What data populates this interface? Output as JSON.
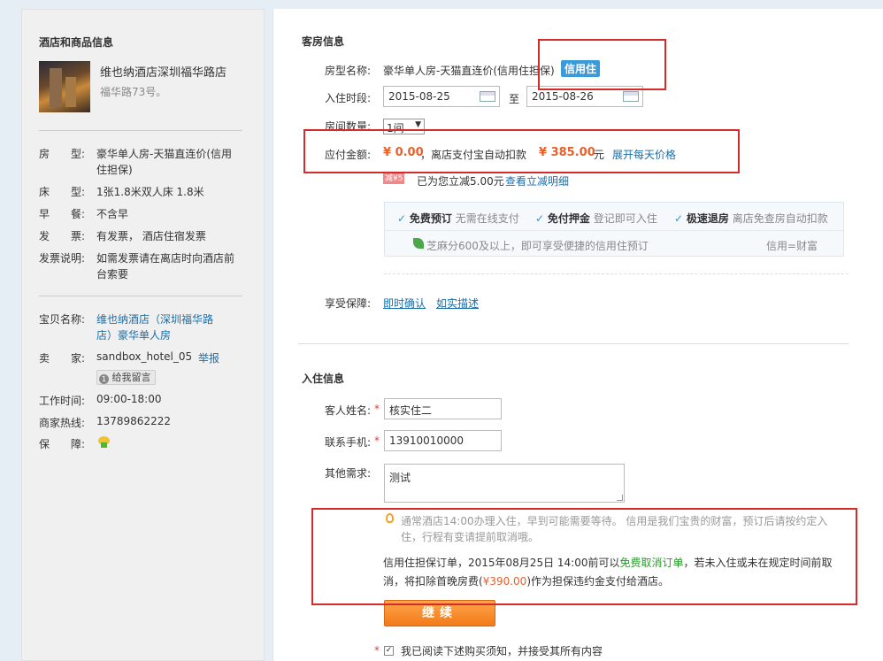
{
  "sidebar": {
    "title": "酒店和商品信息",
    "hotel_name": "维也纳酒店深圳福华路店",
    "hotel_address": "福华路73号。",
    "rows": [
      {
        "label": "房　　型:",
        "value": "豪华单人房-天猫直连价(信用住担保)"
      },
      {
        "label": "床　　型:",
        "value": "1张1.8米双人床 1.8米"
      },
      {
        "label": "早　　餐:",
        "value": "不含早"
      },
      {
        "label": "发　　票:",
        "value": "有发票， 酒店住宿发票"
      },
      {
        "label": "发票说明:",
        "value": "如需发票请在离店时向酒店前台索要"
      }
    ],
    "product_label": "宝贝名称:",
    "product_name": "维也纳酒店（深圳福华路店）豪华单人房",
    "seller_label": "卖　　家:",
    "seller_name": "sandbox_hotel_05",
    "report_link": "举报",
    "message_button": "给我留言",
    "hours_label": "工作时间:",
    "hours_value": "09:00-18:00",
    "hotline_label": "商家热线:",
    "hotline_value": "13789862222",
    "guarantee_label": "保　　障:"
  },
  "room": {
    "section_title": "客房信息",
    "room_type_label": "房型名称:",
    "room_type_value": "豪华单人房-天猫直连价(信用住担保)",
    "credit_badge": "信用住",
    "date_label": "入住时段:",
    "checkin_date": "2015-08-25",
    "date_sep": "至",
    "checkout_date": "2015-08-26",
    "count_label": "房间数量:",
    "count_value": "1间",
    "pay_label": "应付金额:",
    "pay_amount": "¥ 0.00",
    "pay_text": "，离店支付宝自动扣款",
    "pay_total": "¥ 385.00",
    "pay_unit": "元",
    "expand_link": "展开每天价格",
    "discount_icon": "减¥5",
    "discount_text": "已为您立减5.00元",
    "discount_link": "查看立减明细",
    "features": [
      {
        "title": "免费预订",
        "desc": "无需在线支付"
      },
      {
        "title": "免付押金",
        "desc": "登记即可入住"
      },
      {
        "title": "极速退房",
        "desc": "离店免查房自动扣款"
      }
    ],
    "zhima_text": "芝麻分600及以上，即可享受便捷的信用住预订",
    "credit_slogan": "信用=财富",
    "protect_label": "享受保障:",
    "protect_links": [
      "即时确认",
      "如实描述"
    ]
  },
  "guest": {
    "section_title": "入住信息",
    "name_label": "客人姓名:",
    "name_value": "核实住二",
    "phone_label": "联系手机:",
    "phone_value": "13910010000",
    "other_label": "其他需求:",
    "other_value": "测试",
    "tip_text": "通常酒店14:00办理入住，早到可能需要等待。 信用是我们宝贵的财富，预订后请按约定入住，行程有变请提前取消哦。",
    "policy_prefix": "信用住担保订单，2015年08月25日 14:00前可以",
    "policy_free": "免费取消订单",
    "policy_mid": "，若未入住或未在规定时间前取消，将扣除首晚房费(",
    "policy_amount": "¥390.00",
    "policy_suffix": ")作为担保违约金支付给酒店。",
    "continue_button": "继续",
    "agree_text": "我已阅读下述购买须知，并接受其所有内容"
  },
  "colors": {
    "accent_orange": "#e8612c",
    "link_blue": "#1a6ea8",
    "badge_blue": "#3a9bd8",
    "annotation_red": "#d52b2b"
  }
}
